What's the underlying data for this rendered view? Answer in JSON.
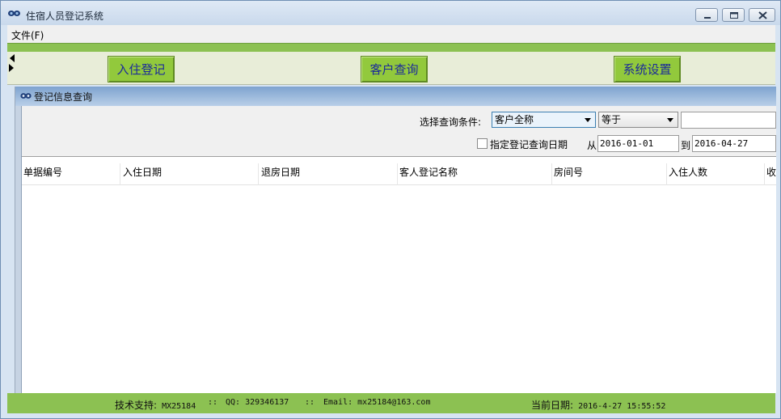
{
  "window": {
    "title": "住宿人员登记系统"
  },
  "menu": {
    "file": "文件(F)"
  },
  "toolbar": {
    "checkin": "入住登记",
    "customer_query": "客户查询",
    "system_settings": "系统设置"
  },
  "panel": {
    "title": "登记信息查询",
    "condition_label": "选择查询条件:",
    "condition_field": "客户全称",
    "operator": "等于",
    "query_value": "",
    "date_checkbox_label": "指定登记查询日期",
    "date_checked": false,
    "from_label": "从",
    "from_date": "2016-01-01",
    "to_label": "到",
    "to_date": "2016-04-27"
  },
  "table": {
    "columns": [
      "单据编号",
      "入住日期",
      "退房日期",
      "客人登记名称",
      "房间号",
      "入住人数",
      "收"
    ],
    "rows": []
  },
  "status": {
    "support_label": "技术支持:",
    "support_value": "MX25184",
    "qq_label": "QQ:",
    "qq_value": "329346137",
    "email_label": "Email:",
    "email_value": "mx25184@163.com",
    "date_label": "当前日期:",
    "date_value": "2016-4-27 15:55:52"
  },
  "colors": {
    "accent_green": "#8cc152",
    "button_green": "#92c93c",
    "panel_title_blue": "#7ea3cf"
  }
}
